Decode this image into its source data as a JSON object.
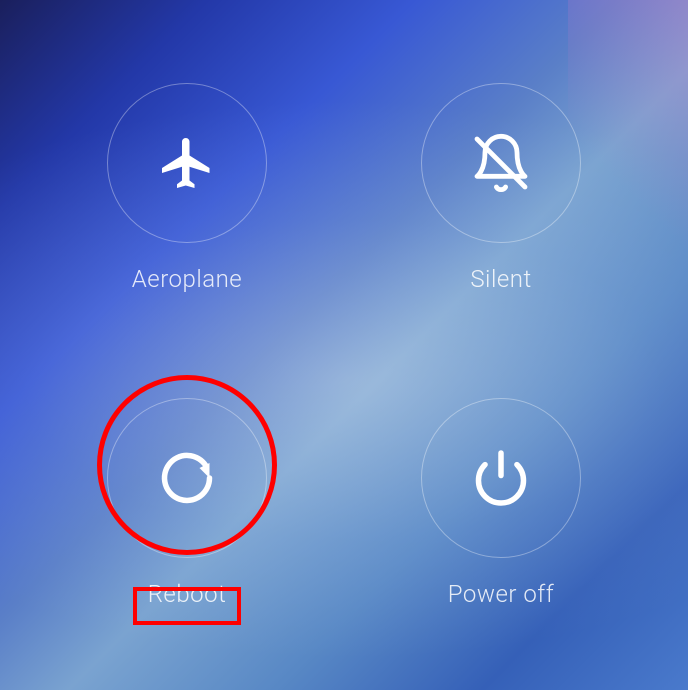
{
  "options": {
    "aeroplane": {
      "label": "Aeroplane",
      "icon": "airplane-icon"
    },
    "silent": {
      "label": "Silent",
      "icon": "bell-off-icon"
    },
    "reboot": {
      "label": "Reboot",
      "icon": "restart-icon",
      "highlighted": true
    },
    "poweroff": {
      "label": "Power off",
      "icon": "power-icon"
    }
  }
}
